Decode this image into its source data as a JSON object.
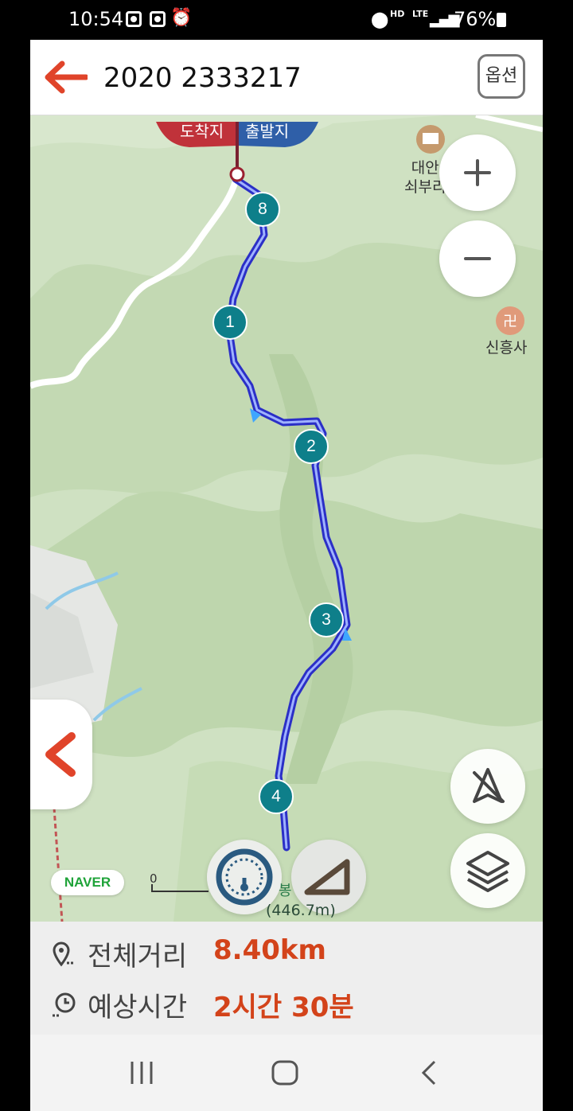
{
  "status_bar": {
    "time": "10:54",
    "hd_label": "HD",
    "lte_label": "LTE",
    "battery": "76%"
  },
  "header": {
    "title": "2020 2333217",
    "option_label": "옵션",
    "accent_color": "#e0442a"
  },
  "map": {
    "flags": {
      "arrival": "도착지",
      "departure": "출발지"
    },
    "poi_1": {
      "line1": "대안",
      "line2": "쇠부리"
    },
    "poi_2": "신흥사",
    "provider": "NAVER",
    "scale_label": "0",
    "peak_name": "봉",
    "peak_elevation": "(446.7m)",
    "markers": [
      "8",
      "1",
      "2",
      "3",
      "4"
    ],
    "route_color": "#2b2fc7",
    "marker_color": "#0e7f8a"
  },
  "info": {
    "distance_label": "전체거리",
    "distance_value": "8.40km",
    "time_label": "예상시간",
    "time_value": "2시간 30분"
  },
  "nav": {
    "icons": [
      "recent-apps-icon",
      "home-icon",
      "back-icon"
    ]
  }
}
